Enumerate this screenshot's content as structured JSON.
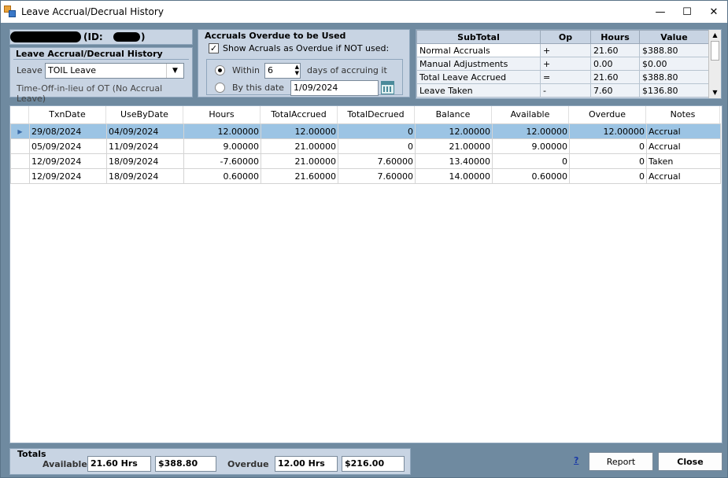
{
  "window": {
    "title": "Leave Accrual/Decrual History",
    "minimize": "—",
    "maximize": "☐",
    "close": "✕"
  },
  "employee": {
    "id_label": "(ID: ",
    "id_suffix": ")"
  },
  "history_group": {
    "title": "Leave Accrual/Decrual History",
    "leave_label": "Leave",
    "leave_value": "TOIL Leave",
    "leave_description": "Time-Off-in-lieu of OT (No Accrual Leave)"
  },
  "overdue_group": {
    "title": "Accruals Overdue to be Used",
    "show_checkbox_label": "Show Acruals as Overdue if NOT used:",
    "within_label": "Within",
    "within_value": "6",
    "days_label": "days of accruing it",
    "by_date_label": "By this date",
    "by_date_value": "1/09/2024"
  },
  "subtotal": {
    "headers": [
      "SubTotal",
      "Op",
      "Hours",
      "Value"
    ],
    "rows": [
      {
        "name": "Normal Accruals",
        "op": "+",
        "hours": "21.60",
        "value": "$388.80"
      },
      {
        "name": "Manual Adjustments",
        "op": "+",
        "hours": "0.00",
        "value": "$0.00"
      },
      {
        "name": "Total Leave Accrued",
        "op": "=",
        "hours": "21.60",
        "value": "$388.80"
      },
      {
        "name": "Leave Taken",
        "op": "-",
        "hours": "7.60",
        "value": "$136.80"
      }
    ]
  },
  "grid": {
    "headers": [
      "TxnDate",
      "UseByDate",
      "Hours",
      "TotalAccrued",
      "TotalDecrued",
      "Balance",
      "Available",
      "Overdue",
      "Notes"
    ],
    "rows": [
      {
        "txn": "29/08/2024",
        "useby": "04/09/2024",
        "hours": "12.00000",
        "acc": "12.00000",
        "dec": "0",
        "bal": "12.00000",
        "avail": "12.00000",
        "over": "12.00000",
        "notes": "Accrual"
      },
      {
        "txn": "05/09/2024",
        "useby": "11/09/2024",
        "hours": "9.00000",
        "acc": "21.00000",
        "dec": "0",
        "bal": "21.00000",
        "avail": "9.00000",
        "over": "0",
        "notes": "Accrual"
      },
      {
        "txn": "12/09/2024",
        "useby": "18/09/2024",
        "hours": "-7.60000",
        "acc": "21.00000",
        "dec": "7.60000",
        "bal": "13.40000",
        "avail": "0",
        "over": "0",
        "notes": "Taken"
      },
      {
        "txn": "12/09/2024",
        "useby": "18/09/2024",
        "hours": "0.60000",
        "acc": "21.60000",
        "dec": "7.60000",
        "bal": "14.00000",
        "avail": "0.60000",
        "over": "0",
        "notes": "Accrual"
      }
    ]
  },
  "totals": {
    "title": "Totals",
    "available_label": "Available",
    "available_hours": "21.60 Hrs",
    "available_value": "$388.80",
    "overdue_label": "Overdue",
    "overdue_hours": "12.00 Hrs",
    "overdue_value": "$216.00"
  },
  "footer": {
    "help_label": "?",
    "report_label": "Report",
    "close_label": "Close"
  }
}
